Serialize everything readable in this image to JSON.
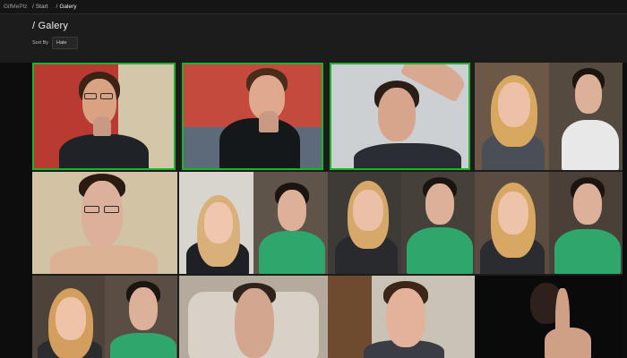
{
  "app": {
    "name": "GifMePlz"
  },
  "breadcrumbs": [
    "Start",
    "Galery"
  ],
  "page": {
    "title": "/ Galery"
  },
  "sort": {
    "label": "Sort By",
    "selected": "Hate"
  },
  "colors": {
    "background": "#1c1c1c",
    "active_border": "#1db32c"
  },
  "gallery": {
    "tile_count": 12,
    "columns": 4,
    "rows": 3,
    "highlighted_tiles": 3,
    "persons_per_tile": [
      1,
      1,
      1,
      2,
      1,
      2,
      2,
      2,
      2,
      1,
      1,
      1
    ]
  }
}
